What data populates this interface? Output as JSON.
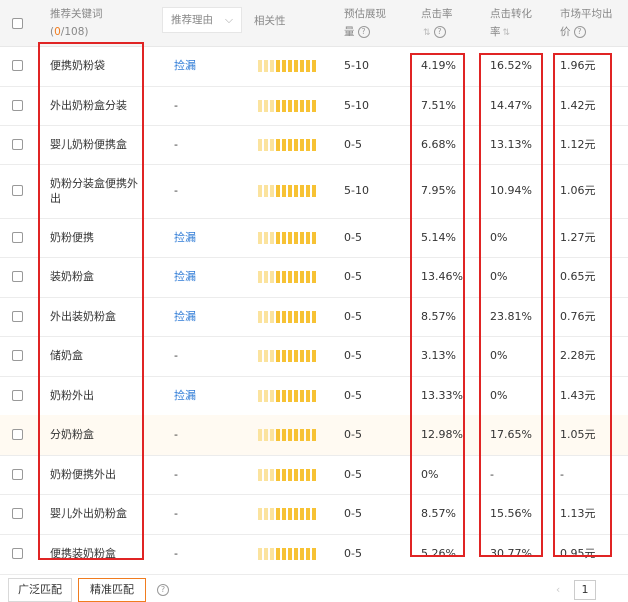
{
  "header": {
    "keyword_label": "推荐关键词",
    "keyword_count_open": "(",
    "keyword_selected": "0",
    "keyword_total": "/108",
    "keyword_count_close": ")",
    "reason_label": "推荐理由",
    "relevance_label": "相关性",
    "volume_label_1": "预估展现",
    "volume_label_2": "量",
    "ctr_label": "点击率",
    "cvr_label_1": "点击转化",
    "cvr_label_2": "率",
    "price_label_1": "市场平均出",
    "price_label_2": "价"
  },
  "rows": [
    {
      "keyword": "便携奶粉袋",
      "reason": "捡漏",
      "relevance": 10,
      "volume": "5-10",
      "ctr": "4.19%",
      "cvr": "16.52%",
      "price": "1.96元"
    },
    {
      "keyword": "外出奶粉盒分装",
      "reason": "-",
      "relevance": 10,
      "volume": "5-10",
      "ctr": "7.51%",
      "cvr": "14.47%",
      "price": "1.42元"
    },
    {
      "keyword": "婴儿奶粉便携盒",
      "reason": "-",
      "relevance": 10,
      "volume": "0-5",
      "ctr": "6.68%",
      "cvr": "13.13%",
      "price": "1.12元"
    },
    {
      "keyword": "奶粉分装盒便携外出",
      "reason": "-",
      "relevance": 10,
      "volume": "5-10",
      "ctr": "7.95%",
      "cvr": "10.94%",
      "price": "1.06元"
    },
    {
      "keyword": "奶粉便携",
      "reason": "捡漏",
      "relevance": 10,
      "volume": "0-5",
      "ctr": "5.14%",
      "cvr": "0%",
      "price": "1.27元"
    },
    {
      "keyword": "装奶粉盒",
      "reason": "捡漏",
      "relevance": 10,
      "volume": "0-5",
      "ctr": "13.46%",
      "cvr": "0%",
      "price": "0.65元"
    },
    {
      "keyword": "外出装奶粉盒",
      "reason": "捡漏",
      "relevance": 10,
      "volume": "0-5",
      "ctr": "8.57%",
      "cvr": "23.81%",
      "price": "0.76元"
    },
    {
      "keyword": "储奶盒",
      "reason": "-",
      "relevance": 10,
      "volume": "0-5",
      "ctr": "3.13%",
      "cvr": "0%",
      "price": "2.28元"
    },
    {
      "keyword": "奶粉外出",
      "reason": "捡漏",
      "relevance": 10,
      "volume": "0-5",
      "ctr": "13.33%",
      "cvr": "0%",
      "price": "1.43元"
    },
    {
      "keyword": "分奶粉盒",
      "reason": "-",
      "relevance": 10,
      "volume": "0-5",
      "ctr": "12.98%",
      "cvr": "17.65%",
      "price": "1.05元"
    },
    {
      "keyword": "奶粉便携外出",
      "reason": "-",
      "relevance": 10,
      "volume": "0-5",
      "ctr": "0%",
      "cvr": "-",
      "price": "-"
    },
    {
      "keyword": "婴儿外出奶粉盒",
      "reason": "-",
      "relevance": 10,
      "volume": "0-5",
      "ctr": "8.57%",
      "cvr": "15.56%",
      "price": "1.13元"
    },
    {
      "keyword": "便携装奶粉盒",
      "reason": "-",
      "relevance": 10,
      "volume": "0-5",
      "ctr": "5.26%",
      "cvr": "30.77%",
      "price": "0.95元"
    }
  ],
  "footer": {
    "broad_match": "广泛匹配",
    "exact_match": "精准匹配",
    "page": "1"
  },
  "colors": {
    "accent": "#f07c1f",
    "link": "#2e7bd6",
    "highlight_box": "#e02424",
    "relevance_bar": "#f7c234"
  }
}
